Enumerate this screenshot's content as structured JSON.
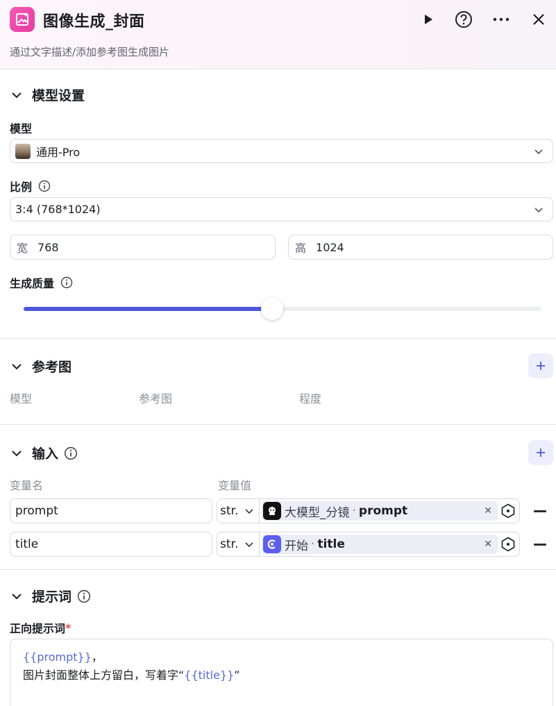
{
  "header": {
    "title": "图像生成_封面",
    "subtitle": "通过文字描述/添加参考图生成图片",
    "icons": [
      "run-icon",
      "help-icon",
      "more-icon",
      "close-icon"
    ]
  },
  "model_settings": {
    "section_title": "模型设置",
    "model_label": "模型",
    "model_value": "通用-Pro",
    "ratio_label": "比例",
    "ratio_value": "3:4 (768*1024)",
    "width_prefix": "宽",
    "width_value": "768",
    "height_prefix": "高",
    "height_value": "1024",
    "quality_label": "生成质量",
    "quality_level": 0.48
  },
  "reference": {
    "section_title": "参考图",
    "columns": [
      "模型",
      "参考图",
      "程度"
    ]
  },
  "inputs": {
    "section_title": "输入",
    "col_name": "变量名",
    "col_value": "变量值",
    "rows": [
      {
        "name": "prompt",
        "type": "str.",
        "source": "大模型_分镜",
        "sep": "·",
        "variable": "prompt"
      },
      {
        "name": "title",
        "type": "str.",
        "source": "开始",
        "sep": "·",
        "variable": "title"
      }
    ]
  },
  "prompt": {
    "section_title": "提示词",
    "positive_label": "正向提示词",
    "required_mark": "*",
    "line1_var": "{{prompt}}",
    "line1_suffix": "，",
    "line2_prefix": "图片封面整体上方留白，写着字“",
    "line2_var": "{{title}}",
    "line2_suffix": "”"
  },
  "colors": {
    "accent": "#4e57dc",
    "app_icon": "#e63aa0",
    "add_button_bg": "#eceefc"
  }
}
